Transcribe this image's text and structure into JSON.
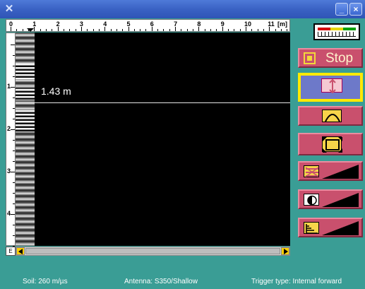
{
  "window": {
    "app_icon": "app-logo-icon",
    "minimize_glyph": "_",
    "close_glyph": "×"
  },
  "ruler_h": {
    "labels": [
      "0",
      "1",
      "2",
      "3",
      "4",
      "5",
      "6",
      "7",
      "8",
      "9",
      "10",
      "11"
    ],
    "unit": "[m]"
  },
  "ruler_v": {
    "labels": [
      "1",
      "2",
      "3",
      "4"
    ]
  },
  "display": {
    "depth_marker_label": "1.43 m"
  },
  "scroll": {
    "unit_box": "E"
  },
  "meter": {
    "colors": [
      "#d40000",
      "#e8d600",
      "#00a000"
    ]
  },
  "controls": {
    "stop_label": "Stop",
    "depth_cursor_icon": "depth-cursor-icon",
    "hyperbola_icon": "hyperbola-fit-icon",
    "zoom_icon": "zoom-extent-icon",
    "filter_icon": "background-filter-icon",
    "contrast_icon": "contrast-icon",
    "gain_icon": "gain-steps-icon"
  },
  "colors": {
    "background": "#3a9d95",
    "button": "#c9506d",
    "selected_button": "#6d79c9",
    "selection_border": "#ffea00"
  },
  "status": {
    "soil": "Soil:  260 m/µs",
    "antenna": "Antenna: S350/Shallow",
    "trigger": "Trigger type: Internal forward"
  }
}
